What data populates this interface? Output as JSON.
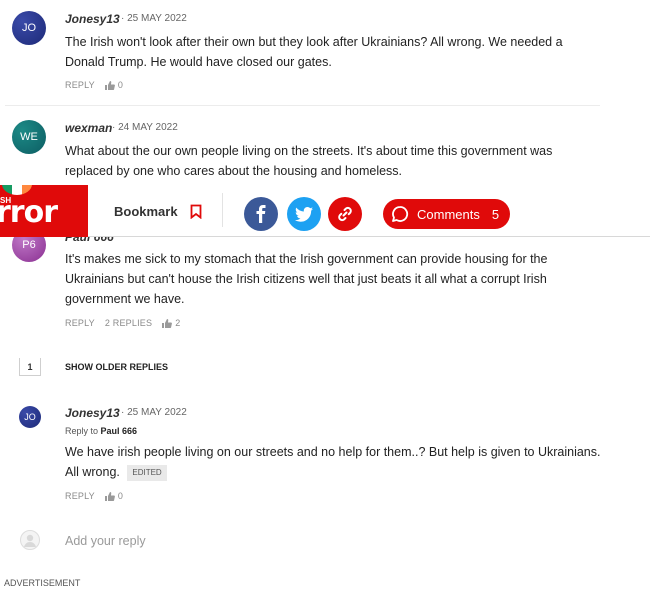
{
  "comments": [
    {
      "initials": "JO",
      "author": "Jonesy13",
      "date": "· 25 MAY 2022",
      "text_line1": "The Irish won't look after their own but they look after Ukrainians? All wrong. We needed a",
      "text_line2": "Donald Trump. He would have closed our gates.",
      "reply_label": "REPLY",
      "likes": "0"
    },
    {
      "initials": "WE",
      "author": "wexman",
      "date": "· 24 MAY 2022",
      "text_line1": "What about the our own people living on the streets. It's about time this government was",
      "text_line2": "replaced by one who cares about the housing and homeless."
    },
    {
      "initials": "P6",
      "author_partial": "Paul 666",
      "text_line1": "It's makes me sick to my stomach that the Irish government can provide housing for the",
      "text_line2": "Ukrainians but can't house the Irish citizens well that just beats it all what a corrupt Irish",
      "text_line3": "government we have.",
      "reply_label": "REPLY",
      "replies_label": "2 REPLIES",
      "likes": "2"
    }
  ],
  "thread": {
    "count": "1",
    "show_older": "SHOW OLDER REPLIES"
  },
  "reply": {
    "initials": "JO",
    "author": "Jonesy13",
    "date": "· 25 MAY 2022",
    "reply_to_prefix": "Reply to ",
    "reply_to_name": "Paul 666",
    "text_line1": "We have irish people living on our streets and no help for them..? But help is given to Ukrainians.",
    "text_line2": "All wrong.",
    "edited_label": "EDITED",
    "reply_label": "REPLY",
    "likes": "0"
  },
  "add_reply_placeholder": "Add your reply",
  "advertisement_label": "ADVERTISEMENT",
  "sticky_bar": {
    "logo_tag": "SH",
    "logo_text": "rror",
    "bookmark_label": "Bookmark",
    "comments_label": "Comments",
    "comments_count": "5",
    "brand_color": "#e00a0a",
    "facebook_color": "#3b5998",
    "twitter_color": "#1da1f2"
  }
}
